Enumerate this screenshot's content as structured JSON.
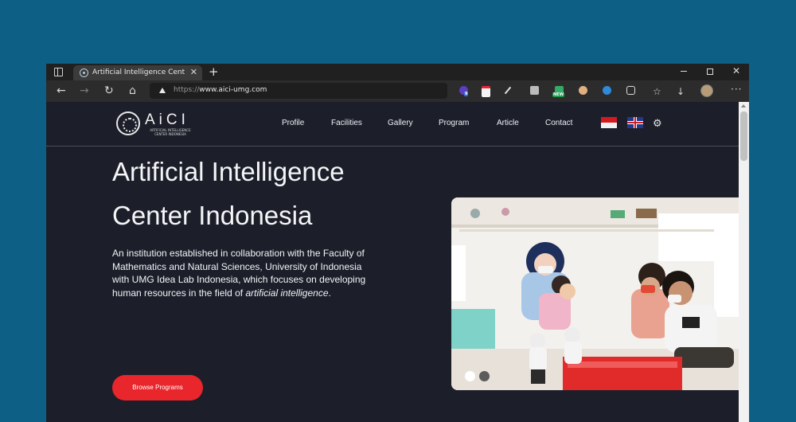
{
  "browser": {
    "tab": {
      "title": "Artificial Intelligence Center Indo",
      "close": "✕"
    },
    "new_tab": "+",
    "window": {
      "close": "✕"
    },
    "nav": {
      "back": "←",
      "forward": "→",
      "refresh": "↻",
      "home": "⌂"
    },
    "url": {
      "scheme": "https://",
      "host": "www.aici-umg.com"
    },
    "extensions": [
      {
        "icon": "extension-purple-icon",
        "badge": "9"
      },
      {
        "icon": "extension-calendar-icon"
      },
      {
        "icon": "pen-icon"
      },
      {
        "icon": "camera-icon"
      },
      {
        "icon": "extension-new-icon",
        "badge": "NEW"
      },
      {
        "icon": "extension-face-icon"
      },
      {
        "icon": "extension-gem-icon"
      },
      {
        "icon": "puzzle-icon"
      },
      {
        "icon": "favorites-icon"
      },
      {
        "icon": "download-icon"
      }
    ],
    "menu": "···"
  },
  "site": {
    "logo": {
      "text": "AiCI",
      "sub": "ARTIFICIAL INTELLIGENCE CENTER INDONESIA"
    },
    "nav": [
      "Profile",
      "Facilities",
      "Gallery",
      "Program",
      "Article",
      "Contact"
    ],
    "languages": [
      "id-flag",
      "uk-flag"
    ],
    "settings_icon": "⚙"
  },
  "hero": {
    "title_line1": "Artificial Intelligence",
    "title_line2": "Center Indonesia",
    "desc_main": "An institution established in collaboration with the Faculty of Mathematics and Natural Sciences, University of Indonesia with UMG Idea Lab Indonesia, which focuses on developing human resources in the field of ",
    "desc_emph": "artificial intelligence",
    "desc_end": ".",
    "cta": "Browse Programs"
  },
  "carousel": {
    "slides": 2,
    "active_index": 0
  },
  "colors": {
    "accent": "#e8262b",
    "page_bg": "#1c1f2a",
    "outer_bg": "#0e5f85"
  }
}
